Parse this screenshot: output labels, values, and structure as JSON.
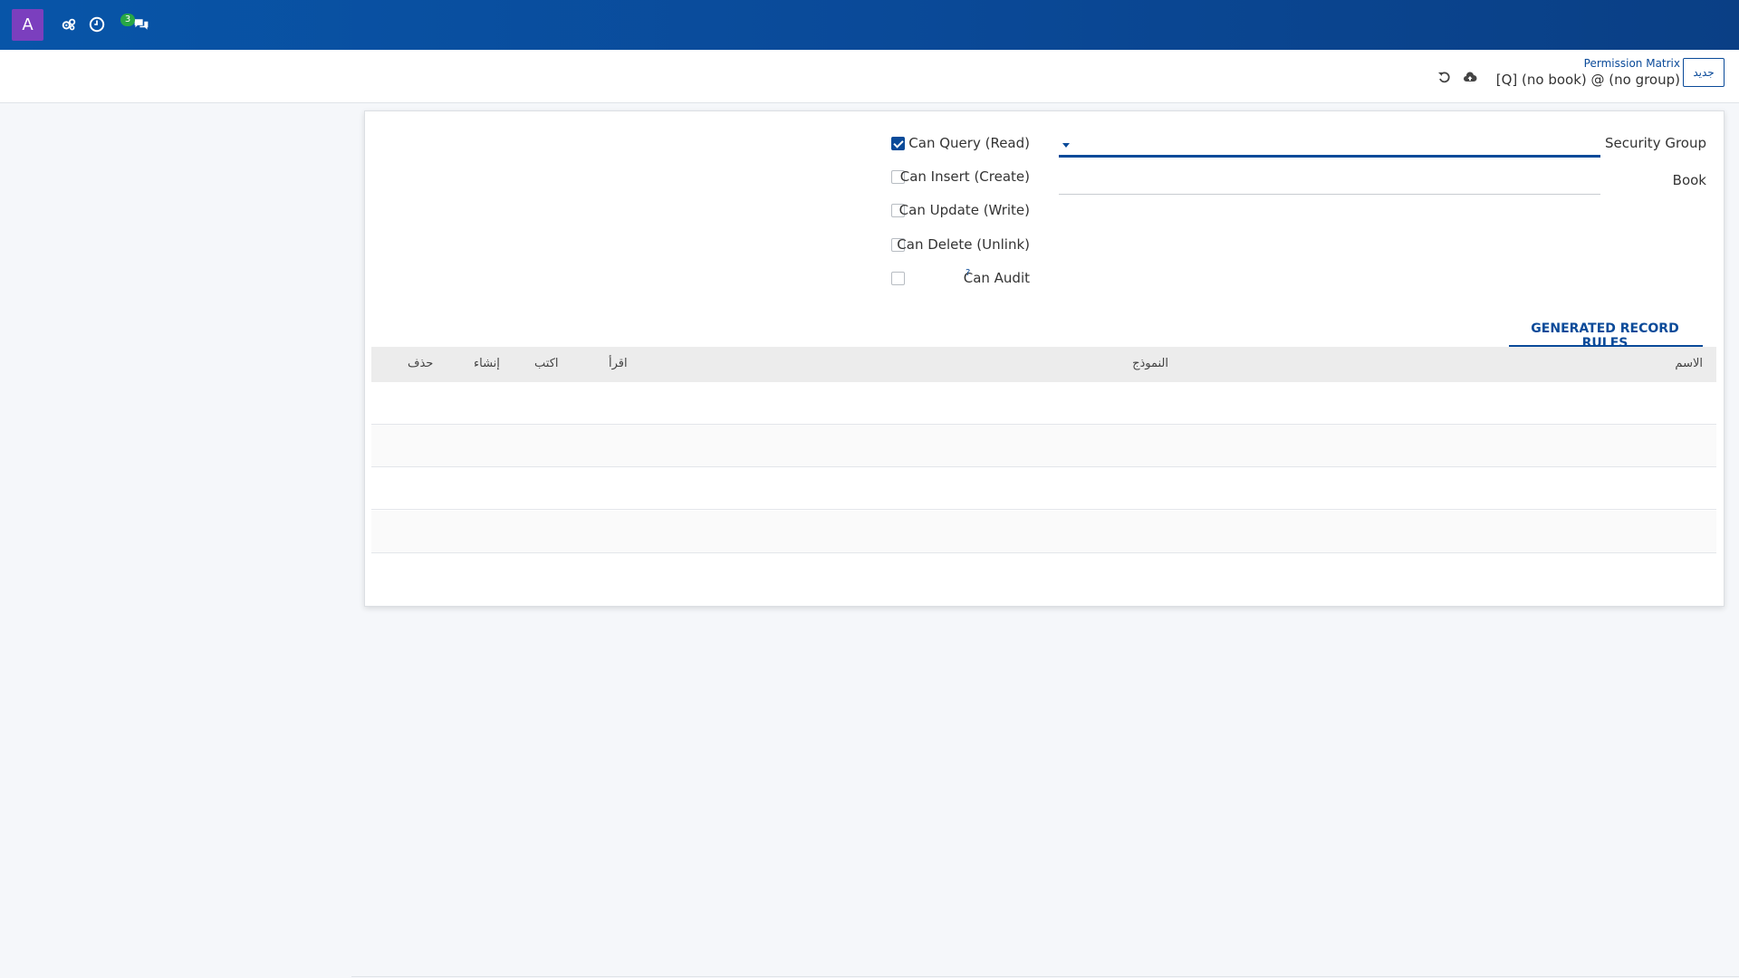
{
  "navbar": {
    "avatar_letter": "A",
    "icons": [
      "gears-icon",
      "clock-icon",
      "chat-icon"
    ],
    "chat_badge": "3"
  },
  "control_panel": {
    "breadcrumb_parent": "Permission Matrix",
    "breadcrumb_current": "[Q] (no book) @ (no group)",
    "new_button": "جديد",
    "icons": [
      "undo-icon",
      "cloud-upload-icon"
    ]
  },
  "form": {
    "security_group_label": "Security Group",
    "security_group_value": "",
    "book_label": "Book",
    "book_value": "",
    "permissions": [
      {
        "label": "Can Query (Read)",
        "checked": true
      },
      {
        "label": "Can Insert (Create)",
        "checked": false
      },
      {
        "label": "Can Update (Write)",
        "checked": false
      },
      {
        "label": "Can Delete (Unlink)",
        "checked": false
      },
      {
        "label": "Can Audit",
        "checked": false,
        "help": "?"
      }
    ]
  },
  "tabs": [
    {
      "label": "GENERATED RECORD RULES",
      "active": true
    }
  ],
  "table": {
    "columns": [
      "الاسم",
      "النموذج",
      "اقرأ",
      "اكتب",
      "إنشاء",
      "حذف"
    ],
    "rows": []
  },
  "colors": {
    "primary": "#0a4a99",
    "avatar": "#7b3fbe",
    "badge": "#28a745"
  }
}
